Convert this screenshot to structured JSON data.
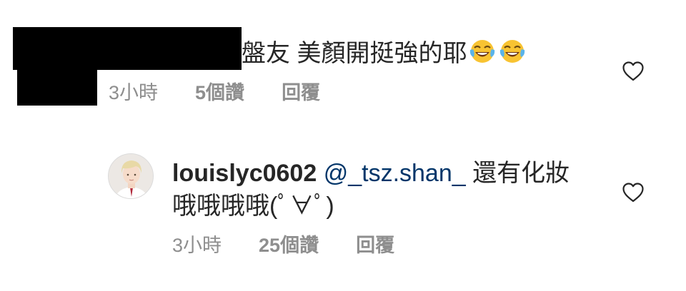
{
  "comment": {
    "text": "盤友 美顏開挺強的耶",
    "emojis": [
      "face-with-tears-of-joy-icon",
      "face-with-tears-of-joy-icon"
    ],
    "time": "3小時",
    "likes": "5個讚",
    "reply_label": "回覆",
    "author_redacted": true
  },
  "reply": {
    "username": "louislyc0602",
    "mention": "@_tsz.shan_",
    "text_part1": "還有化妝",
    "text_part2": "哦哦哦哦(ﾟ∀ﾟ)",
    "time": "3小時",
    "likes": "25個讚",
    "reply_label": "回覆",
    "avatar_icon": "profile-photo"
  },
  "icons": {
    "like": "heart-outline-icon"
  },
  "colors": {
    "text": "#262626",
    "meta": "#8e8e8e",
    "mention": "#003569",
    "background": "#ffffff",
    "redaction": "#000000"
  }
}
